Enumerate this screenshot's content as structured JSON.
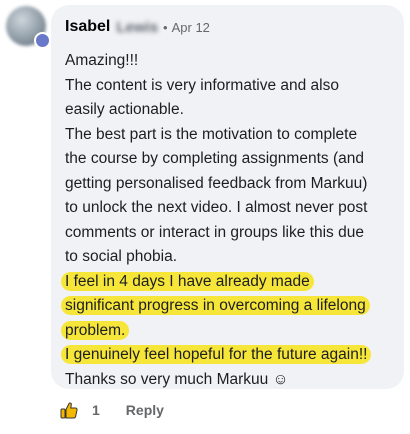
{
  "comment": {
    "author_name": "Isabel",
    "author_surname_blurred": "Lewis",
    "separator": "•",
    "date": "Apr 12",
    "lines": [
      {
        "text": "Amazing!!!",
        "highlight": false
      },
      {
        "text": "The content is very informative and also",
        "highlight": false
      },
      {
        "text": "easily actionable.",
        "highlight": false
      },
      {
        "text": "The best part is the motivation to complete",
        "highlight": false
      },
      {
        "text": "the course by completing assignments (and",
        "highlight": false
      },
      {
        "text": "getting personalised feedback from Markuu)",
        "highlight": false
      },
      {
        "text": "to unlock the next video. I almost never post",
        "highlight": false
      },
      {
        "text": "comments or interact in groups like this due",
        "highlight": false
      },
      {
        "text": "to social phobia.",
        "highlight": false
      },
      {
        "text": "I feel in 4 days I have already made",
        "highlight": true
      },
      {
        "text": "significant progress in overcoming a lifelong",
        "highlight": true
      },
      {
        "text": "problem.",
        "highlight": true
      },
      {
        "text": "I genuinely feel hopeful for the future again!!",
        "highlight": true
      },
      {
        "text": "Thanks so very much Markuu ☺",
        "highlight": false
      }
    ]
  },
  "actions": {
    "like_icon": "thumbs-up-icon",
    "like_count": "1",
    "reply_label": "Reply"
  },
  "colors": {
    "bubble_background": "#f0f2f5",
    "highlight": "#f7e63a",
    "muted_text": "#65676b"
  }
}
